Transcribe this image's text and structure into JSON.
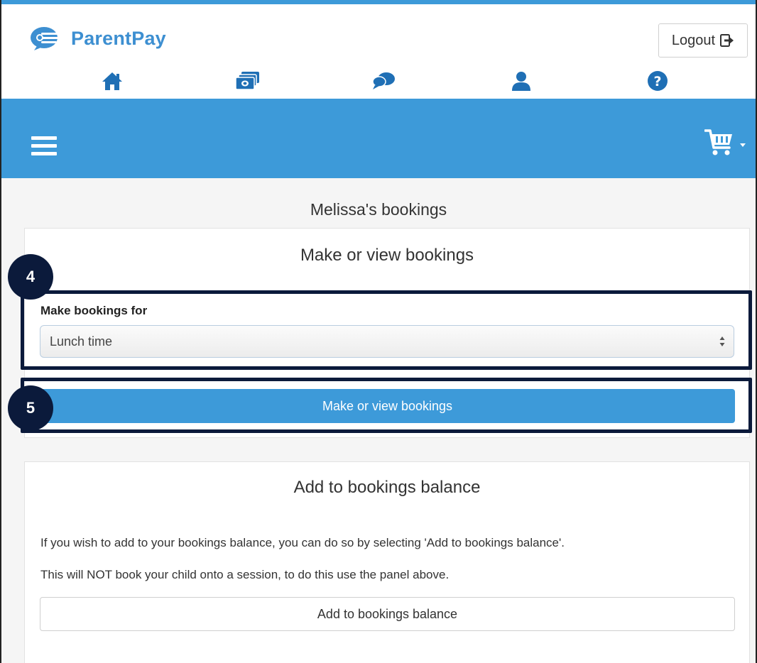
{
  "header": {
    "logo_text": "ParentPay",
    "logout_label": "Logout",
    "nav_icons": [
      "home-icon",
      "payments-icon",
      "messages-icon",
      "profile-icon",
      "help-icon"
    ]
  },
  "toolbar": {
    "menu_icon": "hamburger-menu-icon",
    "cart_icon": "cart-icon"
  },
  "page": {
    "title": "Melissa's bookings"
  },
  "bookings_panel": {
    "heading": "Make or view bookings",
    "field_label": "Make bookings for",
    "selected_option": "Lunch time",
    "button_label": "Make or view bookings"
  },
  "balance_panel": {
    "heading": "Add to bookings balance",
    "text_1": "If you wish to add to your bookings balance, you can do so by selecting 'Add to bookings balance'.",
    "text_2": "This will NOT book your child onto a session, to do this use the panel above.",
    "button_label": "Add to bookings balance"
  },
  "callouts": {
    "step_4": "4",
    "step_5": "5"
  },
  "colors": {
    "brand_blue": "#3d9ad9",
    "callout_navy": "#0b1a3b"
  }
}
